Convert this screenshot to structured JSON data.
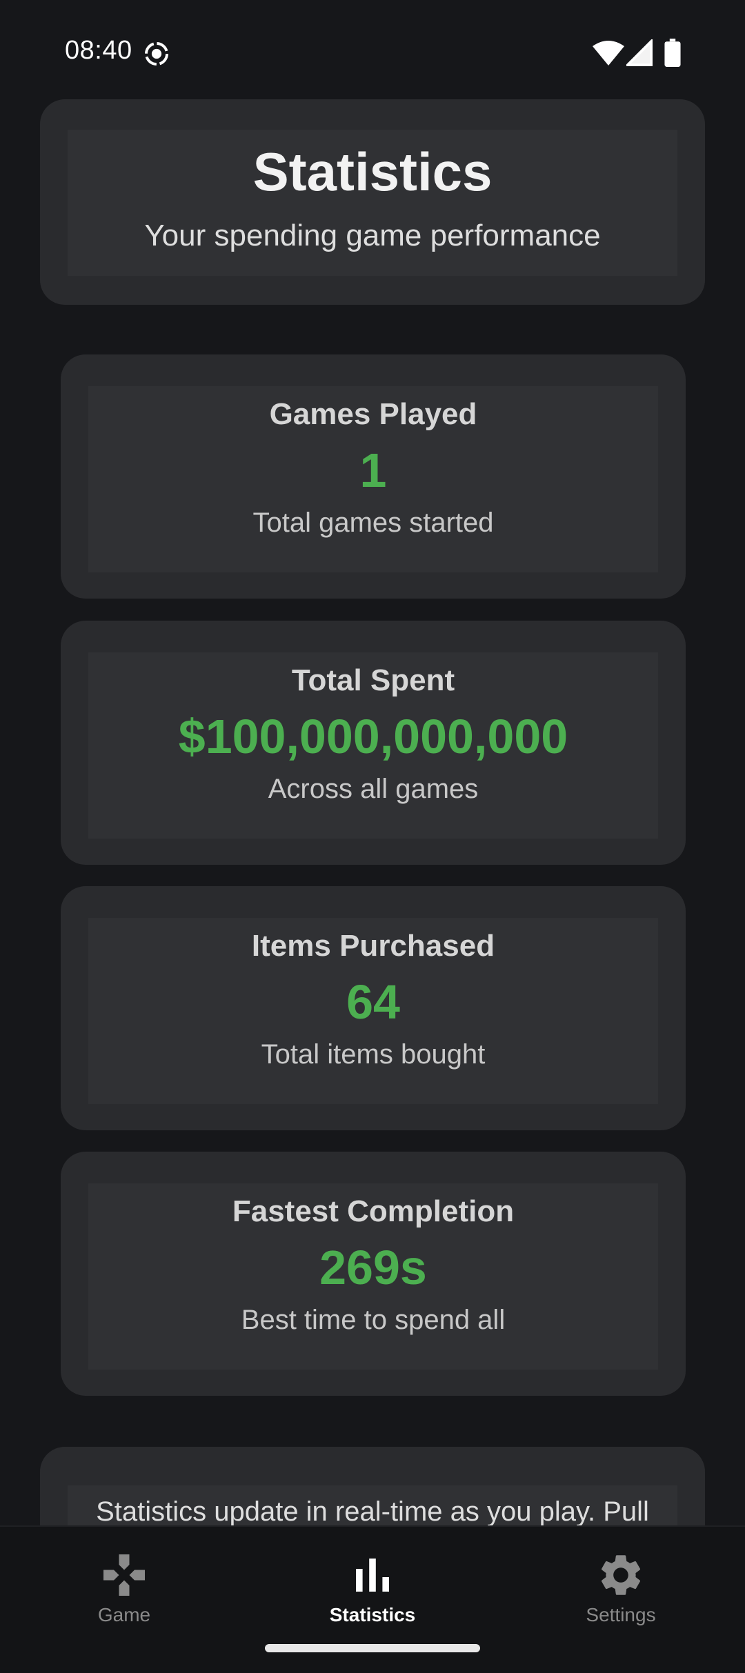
{
  "status_bar": {
    "time": "08:40"
  },
  "header": {
    "title": "Statistics",
    "subtitle": "Your spending game performance"
  },
  "stats": [
    {
      "label": "Games Played",
      "value": "1",
      "description": "Total games started"
    },
    {
      "label": "Total Spent",
      "value": "$100,000,000,000",
      "description": "Across all games"
    },
    {
      "label": "Items Purchased",
      "value": "64",
      "description": "Total items bought"
    },
    {
      "label": "Fastest Completion",
      "value": "269s",
      "description": "Best time to spend all"
    }
  ],
  "info": {
    "text": "Statistics update in real-time as you play. Pull"
  },
  "nav": {
    "items": [
      {
        "label": "Game",
        "icon": "gamepad-icon",
        "active": false
      },
      {
        "label": "Statistics",
        "icon": "bar-chart-icon",
        "active": true
      },
      {
        "label": "Settings",
        "icon": "gear-icon",
        "active": false
      }
    ]
  },
  "colors": {
    "background": "#16171a",
    "card": "#2a2b2e",
    "card_inner": "#303134",
    "accent_value": "#4caf50",
    "nav_active": "#ffffff",
    "nav_inactive": "#8a8a8a"
  }
}
